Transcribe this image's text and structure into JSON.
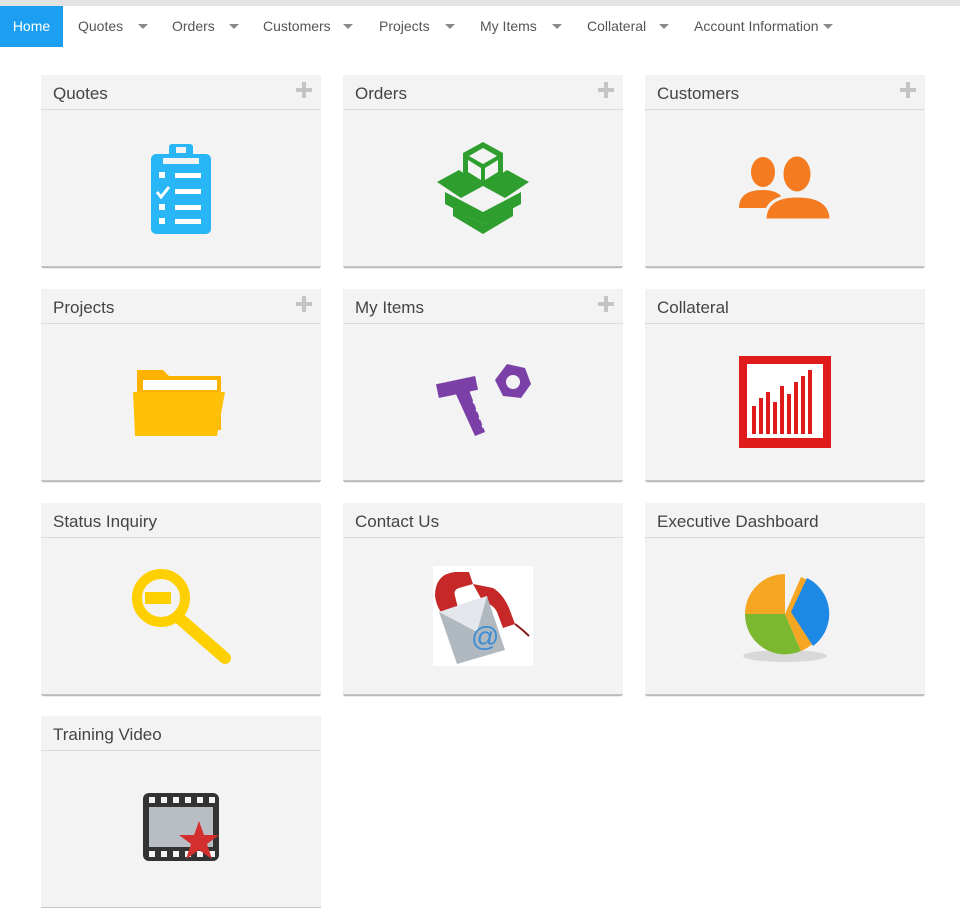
{
  "nav": {
    "home": "Home",
    "items": [
      "Quotes",
      "Orders",
      "Customers",
      "Projects",
      "My Items",
      "Collateral",
      "Account Information"
    ]
  },
  "tiles": [
    {
      "title": "Quotes",
      "icon": "clipboard-checklist-icon",
      "color": "#29b6f6",
      "has_add": true
    },
    {
      "title": "Orders",
      "icon": "boxes-icon",
      "color": "#2e9e2e",
      "has_add": true
    },
    {
      "title": "Customers",
      "icon": "users-icon",
      "color": "#f47b20",
      "has_add": true
    },
    {
      "title": "Projects",
      "icon": "folder-icon",
      "color": "#ffb300",
      "has_add": true
    },
    {
      "title": "My Items",
      "icon": "tools-icon",
      "color": "#7b3fa8",
      "has_add": true
    },
    {
      "title": "Collateral",
      "icon": "bar-chart-icon",
      "color": "#e01b1b",
      "has_add": false
    },
    {
      "title": "Status Inquiry",
      "icon": "magnifier-icon",
      "color": "#ffd000",
      "has_add": false
    },
    {
      "title": "Contact Us",
      "icon": "phone-email-icon",
      "color": "#c62828",
      "has_add": false
    },
    {
      "title": "Executive Dashboard",
      "icon": "pie-chart-icon",
      "color": "#1e88e5",
      "has_add": false
    },
    {
      "title": "Training Video",
      "icon": "film-star-icon",
      "color": "#d32f2f",
      "has_add": false
    }
  ]
}
